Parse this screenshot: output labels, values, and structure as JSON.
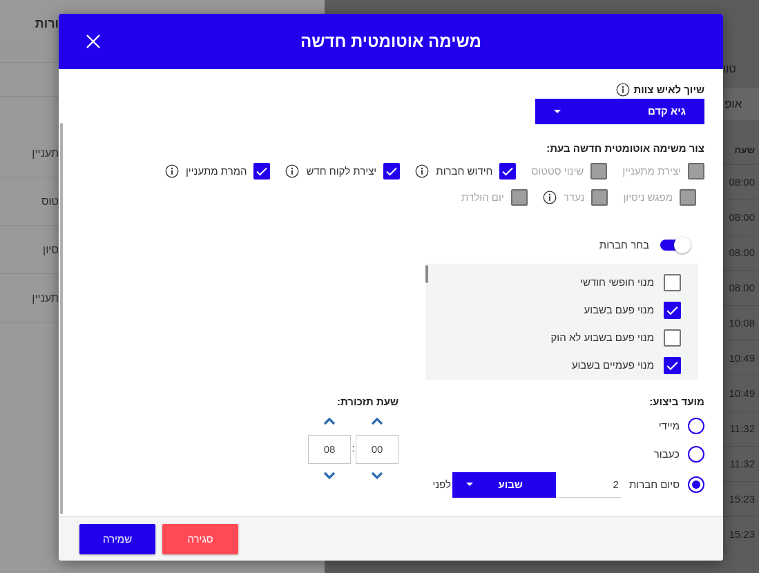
{
  "background_left": {
    "title": "ורות",
    "rows": [
      "תעניין",
      "טוס",
      "סיון",
      "תעניין"
    ]
  },
  "background_right": {
    "tab": "טוו",
    "button": "אופ",
    "column_header": "שעה",
    "times": [
      "08:00",
      "08:00",
      "08:00",
      "08:00",
      "10:08",
      "10:49",
      "10:49",
      "11:32",
      "11:32",
      "15:23",
      "15:23"
    ]
  },
  "dialog": {
    "title": "משימה אוטומטית חדשה",
    "assignee": {
      "label": "שיוך לאיש צוות",
      "info": true,
      "value": "גיא קדם"
    },
    "triggers": {
      "label": "צור משימה אוטומטית חדשה בעת:",
      "rows": [
        [
          {
            "label": "יצירת מתעניין",
            "checked": false,
            "disabled": true,
            "info": false
          },
          {
            "label": "שינוי סטטוס",
            "checked": false,
            "disabled": true,
            "info": false
          },
          {
            "label": "חידוש חברות",
            "checked": true,
            "disabled": false,
            "info": true
          },
          {
            "label": "יצירת לקוח חדש",
            "checked": true,
            "disabled": false,
            "info": true
          },
          {
            "label": "המרת מתעניין",
            "checked": true,
            "disabled": false,
            "info": true
          }
        ],
        [
          {
            "label": "מפגש ניסיון",
            "checked": false,
            "disabled": true,
            "info": false
          },
          {
            "label": "נעדר",
            "checked": false,
            "disabled": true,
            "info": true
          },
          {
            "label": "יום הולדת",
            "checked": false,
            "disabled": true,
            "info": false
          }
        ]
      ]
    },
    "memberships": {
      "toggle_label": "בחר חברות",
      "toggle_on": true,
      "items": [
        {
          "label": "מנוי חופשי חודשי",
          "checked": false
        },
        {
          "label": "מנוי פעם בשבוע",
          "checked": true
        },
        {
          "label": "מנוי פעם בשבוע לא הוק",
          "checked": false
        },
        {
          "label": "מנוי פעמיים בשבוע",
          "checked": true
        }
      ]
    },
    "schedule": {
      "label": "מועד ביצוע:",
      "options": [
        {
          "kind": "plain",
          "label": "מיידי",
          "selected": false
        },
        {
          "kind": "plain",
          "label": "כעבור",
          "selected": false
        },
        {
          "kind": "before",
          "label": "סיום חברות",
          "selected": true,
          "amount": "2",
          "unit": "שבוע",
          "suffix": "לפני"
        }
      ]
    },
    "reminder": {
      "label": "שעת תזכורת:",
      "hour": "08",
      "minute": "00",
      "separator": ":"
    },
    "buttons": [
      {
        "kind": "close",
        "label": "סגירה"
      },
      {
        "kind": "save",
        "label": "שמירה"
      }
    ]
  }
}
